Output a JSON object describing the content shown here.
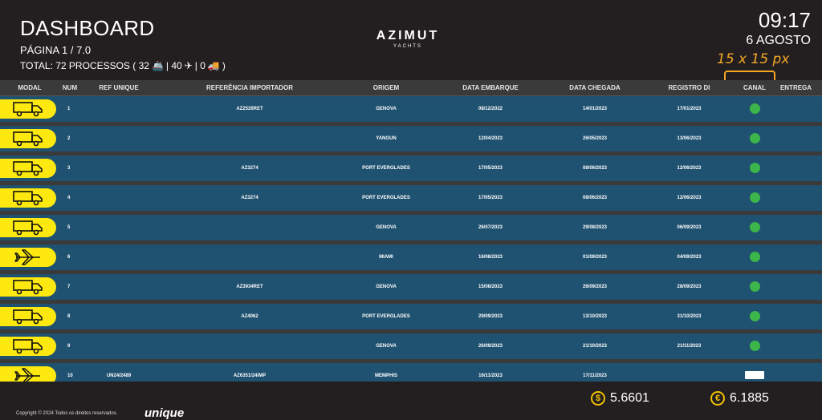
{
  "header": {
    "title": "DASHBOARD",
    "page_label": "PÁGINA 1 / 7.0",
    "total_prefix": "TOTAL: 72 PROCESSOS ( 32",
    "sea_count_sep": "| 40",
    "air_count_sep": "| 0",
    "total_suffix": ")",
    "logo_brand": "AZIMUT",
    "logo_sub": "YACHTS",
    "time": "09:17",
    "date": "6 AGOSTO"
  },
  "annotation": {
    "text": "15 x 15 px",
    "color": "#f5a623"
  },
  "table": {
    "columns": [
      "MODAL",
      "NUM",
      "REF UNIQUE",
      "REFERÊNCIA IMPORTADOR",
      "ORIGEM",
      "DATA EMBARQUE",
      "DATA CHEGADA",
      "REGISTRO DI",
      "CANAL",
      "ENTREGA"
    ],
    "rows": [
      {
        "modal": "truck",
        "num": "1",
        "ref_unique": "",
        "ref_importador": "AZ2526RET",
        "origem": "GENOVA",
        "embarque": "08/12/2022",
        "chegada": "14/01/2023",
        "registro": "17/01/2023",
        "canal": "green",
        "entrega": ""
      },
      {
        "modal": "truck",
        "num": "2",
        "ref_unique": "",
        "ref_importador": "",
        "origem": "YANGUN",
        "embarque": "12/04/2023",
        "chegada": "26/05/2023",
        "registro": "13/06/2023",
        "canal": "green",
        "entrega": ""
      },
      {
        "modal": "truck",
        "num": "3",
        "ref_unique": "",
        "ref_importador": "AZ3274",
        "origem": "PORT EVERGLADES",
        "embarque": "17/05/2023",
        "chegada": "08/06/2023",
        "registro": "12/06/2023",
        "canal": "green",
        "entrega": ""
      },
      {
        "modal": "truck",
        "num": "4",
        "ref_unique": "",
        "ref_importador": "AZ3274",
        "origem": "PORT EVERGLADES",
        "embarque": "17/05/2023",
        "chegada": "08/06/2023",
        "registro": "12/06/2023",
        "canal": "green",
        "entrega": ""
      },
      {
        "modal": "truck",
        "num": "5",
        "ref_unique": "",
        "ref_importador": "",
        "origem": "GENOVA",
        "embarque": "26/07/2023",
        "chegada": "29/08/2023",
        "registro": "06/09/2023",
        "canal": "green",
        "entrega": ""
      },
      {
        "modal": "plane",
        "num": "6",
        "ref_unique": "",
        "ref_importador": "",
        "origem": "MIAMI",
        "embarque": "16/08/2023",
        "chegada": "01/09/2023",
        "registro": "04/09/2023",
        "canal": "green",
        "entrega": ""
      },
      {
        "modal": "truck",
        "num": "7",
        "ref_unique": "",
        "ref_importador": "AZ3934RET",
        "origem": "GENOVA",
        "embarque": "15/08/2023",
        "chegada": "26/09/2023",
        "registro": "28/09/2023",
        "canal": "green",
        "entrega": ""
      },
      {
        "modal": "truck",
        "num": "8",
        "ref_unique": "",
        "ref_importador": "AZ4062",
        "origem": "PORT EVERGLADES",
        "embarque": "29/09/2023",
        "chegada": "13/10/2023",
        "registro": "31/10/2023",
        "canal": "green",
        "entrega": ""
      },
      {
        "modal": "truck",
        "num": "9",
        "ref_unique": "",
        "ref_importador": "",
        "origem": "GENOVA",
        "embarque": "26/09/2023",
        "chegada": "21/10/2023",
        "registro": "21/11/2023",
        "canal": "green",
        "entrega": ""
      },
      {
        "modal": "plane",
        "num": "10",
        "ref_unique": "UN24/2489",
        "ref_importador": "AZ6351/24/MP",
        "origem": "MEMPHIS",
        "embarque": "16/11/2023",
        "chegada": "17/11/2023",
        "registro": "",
        "canal": "white",
        "entrega": ""
      }
    ]
  },
  "footer": {
    "dollar_symbol": "$",
    "dollar_value": "5.6601",
    "euro_symbol": "€",
    "euro_value": "6.1885",
    "copyright": "Copyright © 2024 Todos os direitos reservados.",
    "unique_logo": "unique"
  },
  "colors": {
    "row_bg": "#1f5170",
    "modal_badge": "#fde910",
    "canal_green": "#3cb54a",
    "background": "#231f20"
  }
}
